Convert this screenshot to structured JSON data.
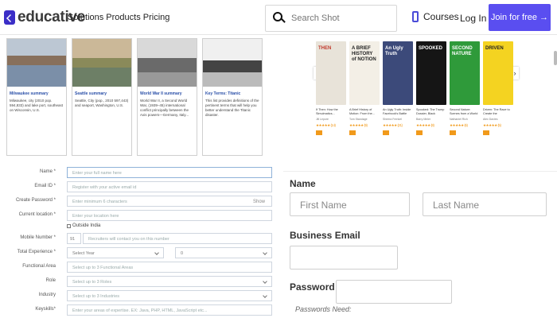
{
  "header": {
    "logo_text": "educative",
    "nav_links": "Solutions Products Pricing",
    "search_placeholder": "Search Shot",
    "courses_label": "Courses",
    "login_label": "Log In",
    "join_label": "Join for free →",
    "accent_color": "#5a4ef0"
  },
  "cards": [
    {
      "title": "Milwaukee summary",
      "body": "Milwaukee, city (2010 pop. 594,833) and lake port, southeast on Wisconsin, U.S."
    },
    {
      "title": "Seattle summary",
      "body": "Seattle, City (pop., 2010 597,443) and seaport, Washington, U.S."
    },
    {
      "title": "World War II summary",
      "body": "World War II, a Second World War, (1939–45) international conflict principally between the Axis powers—Germany, Italy..."
    },
    {
      "title": "Key Terms: Titanic",
      "body": "This list provides definitions of the pertinent terms that will help you better understand the Titanic disaster."
    }
  ],
  "form_left": {
    "name_label": "Name *",
    "name_placeholder": "Enter your full name here",
    "email_label": "Email ID *",
    "email_placeholder": "Register with your active email id",
    "password_label": "Create Password *",
    "password_placeholder": "Enter minimum 6 characters",
    "show_label": "Show",
    "location_label": "Current location *",
    "location_placeholder": "Enter your location here",
    "outside_india": "Outside India",
    "mobile_label": "Mobile Number *",
    "mobile_code": "91",
    "mobile_placeholder": "Recruiters will contact you on this number",
    "experience_label": "Total Experience *",
    "year_placeholder": "Select Year",
    "month_placeholder": "0",
    "functional_label": "Functional Area",
    "functional_placeholder": "Select up to 3 Functional Areas",
    "role_label": "Role",
    "role_placeholder": "Select up to 3 Roles",
    "industry_label": "Industry",
    "industry_placeholder": "Select up to 3 Industries",
    "keyskills_label": "Keyskills*",
    "keyskills_placeholder": "Enter your areas of expertise. EX: Java, PHP, HTML, JavaScript etc..."
  },
  "books": [
    {
      "cover_title": "THEN",
      "title": "If Then: How the Simulmatics...",
      "author": "Jill Lepore",
      "rating": "★★★★★",
      "count": "(14)",
      "cover_color": "#e8e3d9",
      "text_color": "#c0392b"
    },
    {
      "cover_title": "A BRIEF HISTORY of NOTION",
      "title": "A Brief History of Motion: From the...",
      "author": "Tom Standage",
      "rating": "★★★★★",
      "count": "(9)",
      "cover_color": "#f3efe6",
      "text_color": "#222"
    },
    {
      "cover_title": "An Ugly Truth",
      "title": "An Ugly Truth: Inside Facebook's Battle for...",
      "author": "Sheera Frenkel",
      "rating": "★★★★★",
      "count": "(21)",
      "cover_color": "#3c4a7a",
      "text_color": "#fff"
    },
    {
      "cover_title": "SPOOKED",
      "title": "Spooked: The Trump Dossier, Black Cube,...",
      "author": "Barry Meier",
      "rating": "★★★★★",
      "count": "(8)",
      "cover_color": "#151515",
      "text_color": "#fff"
    },
    {
      "cover_title": "SECOND NATURE",
      "title": "Second Nature: Scenes from a World Remade",
      "author": "Nathaniel Rich",
      "rating": "★★★★★",
      "count": "(6)",
      "cover_color": "#2f9a3a",
      "text_color": "#fff"
    },
    {
      "cover_title": "DRIVEN",
      "title": "Driven: The Race to Create the Autonomo...",
      "author": "Alex Davies",
      "rating": "★★★★★",
      "count": "(5)",
      "cover_color": "#f4d321",
      "text_color": "#222"
    }
  ],
  "form_right": {
    "name_label": "Name",
    "first_placeholder": "First Name",
    "last_placeholder": "Last Name",
    "email_label": "Business Email",
    "password_label": "Password",
    "password_note": "Passwords Need:"
  }
}
